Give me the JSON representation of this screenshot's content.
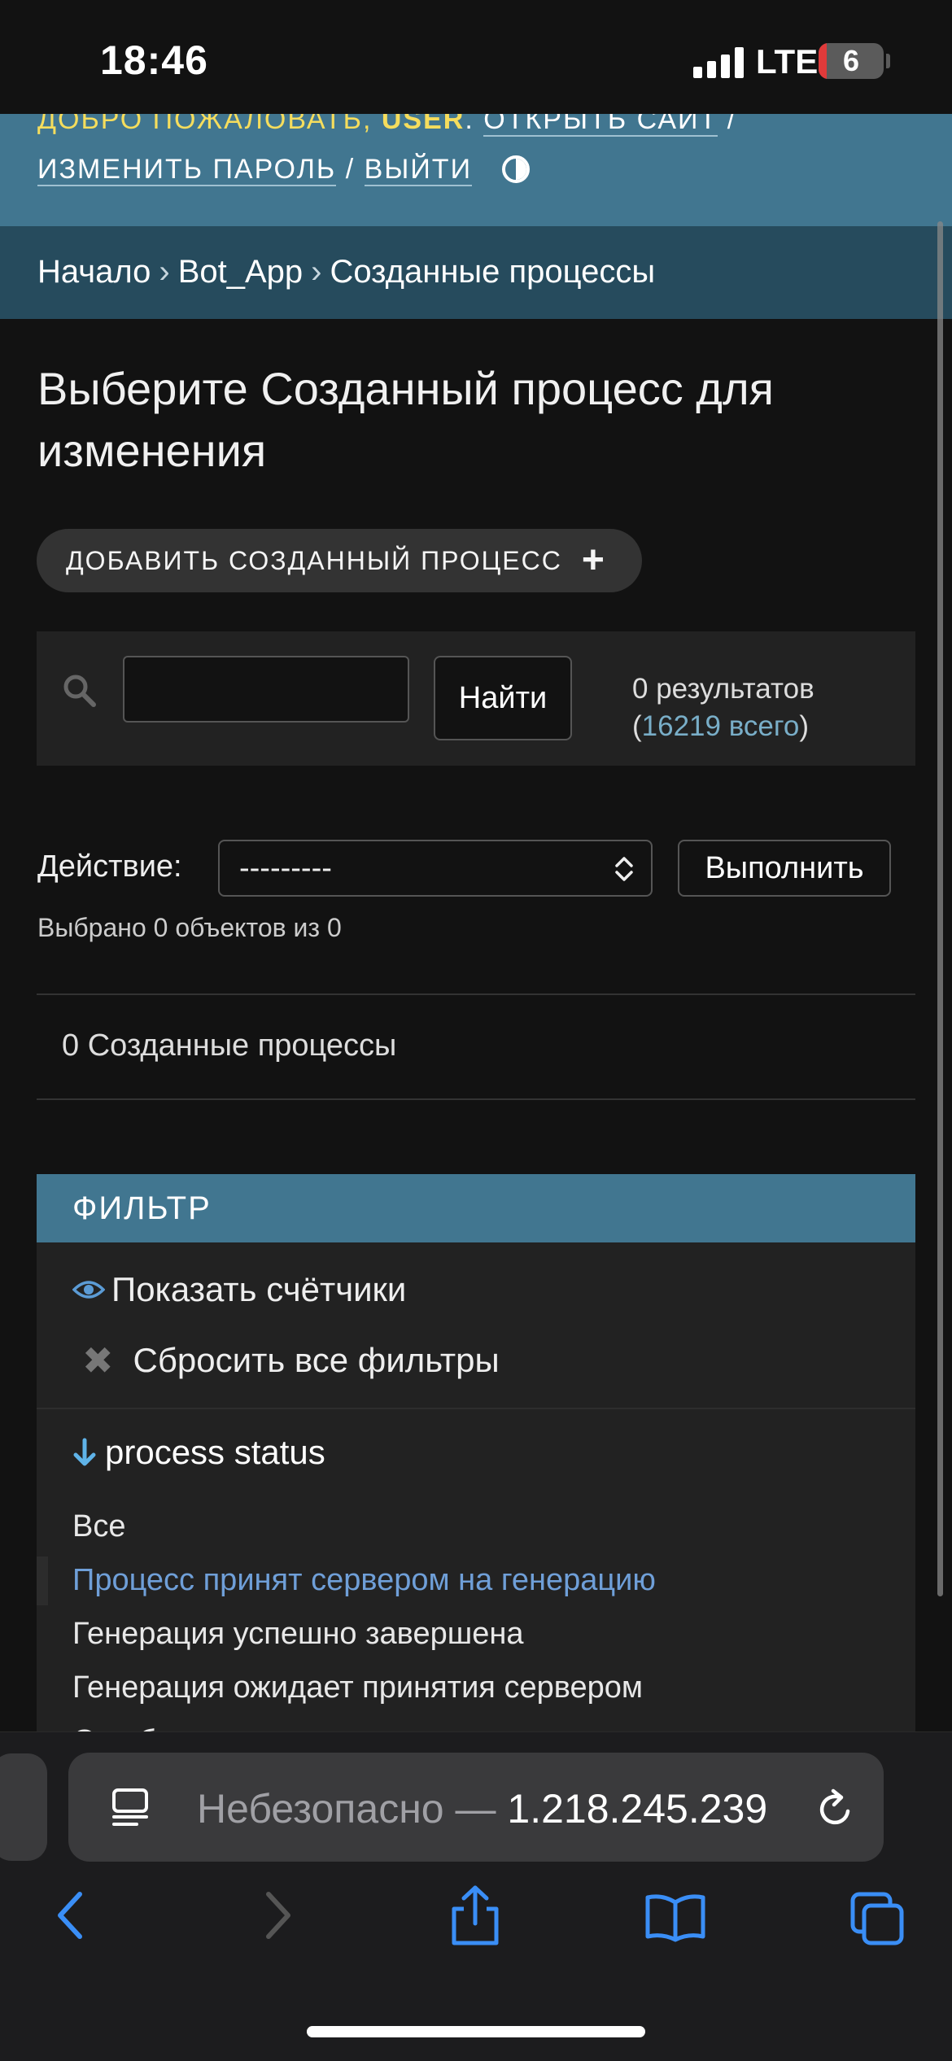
{
  "status_bar": {
    "time": "18:46",
    "network": "LTE",
    "battery": "6"
  },
  "header": {
    "welcome": "ДОБРО ПОЖАЛОВАТЬ,",
    "username": "USER",
    "view_site": "ОТКРЫТЬ САЙТ",
    "change_password": "ИЗМЕНИТЬ ПАРОЛЬ",
    "logout": "ВЫЙТИ",
    "separator": "/"
  },
  "breadcrumbs": [
    "Начало",
    "Bot_App",
    "Созданные процессы"
  ],
  "page_title": "Выберите Созданный процесс для изменения",
  "add_button": {
    "label": "ДОБАВИТЬ СОЗДАННЫЙ ПРОЦЕСС",
    "icon": "plus-icon"
  },
  "search": {
    "value": "",
    "placeholder": "",
    "button": "Найти",
    "results": "0 результатов",
    "total_link": "16219 всего"
  },
  "actions": {
    "label": "Действие:",
    "selected": "---------",
    "run_button": "Выполнить",
    "selected_count": "Выбрано 0 объектов из 0"
  },
  "object_count": "0 Созданные процессы",
  "filter": {
    "header": "ФИЛЬТР",
    "show_counts": "Показать счётчики",
    "reset": "Сбросить все фильтры",
    "title": "process status",
    "choices": [
      "Все",
      "Процесс принят сервером на генерацию",
      "Генерация успешно завершена",
      "Генерация ожидает принятия сервером",
      "Ошибка"
    ],
    "selected_index": 1
  },
  "browser": {
    "security": "Небезопасно —",
    "address": "1.218.245.239"
  },
  "colors": {
    "header_bg": "#417690",
    "breadcrumb_bg": "#264b5d",
    "accent_yellow": "#f5dd5d",
    "link": "#79aec8",
    "ios_blue": "#3a8ef6"
  }
}
